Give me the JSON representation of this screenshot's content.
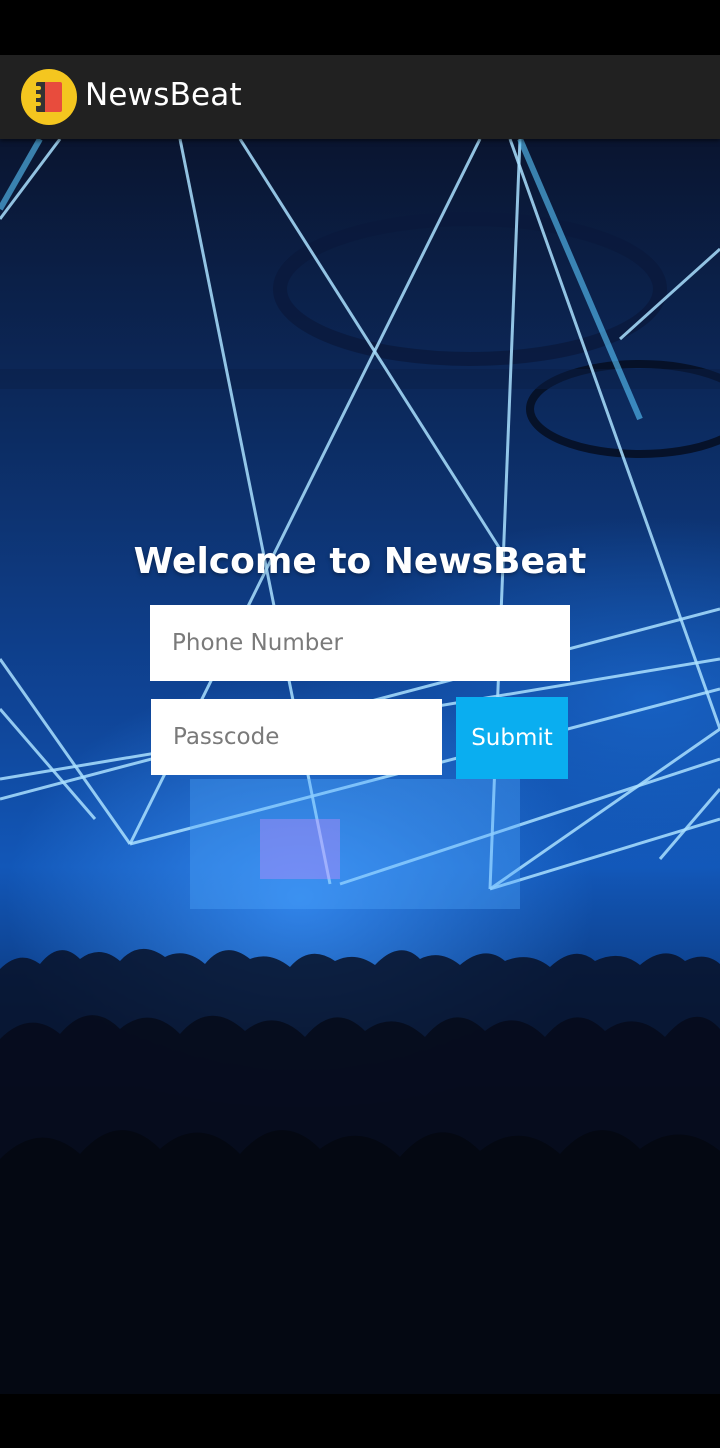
{
  "app_bar": {
    "title": "NewsBeat",
    "logo_icon": "notebook-icon",
    "background": "#212121"
  },
  "login": {
    "heading": "Welcome to NewsBeat",
    "phone_placeholder": "Phone Number",
    "passcode_placeholder": "Passcode",
    "submit_label": "Submit",
    "submit_color": "#0aaef0"
  },
  "background_image": "concert-crowd-with-blue-laser-lights"
}
